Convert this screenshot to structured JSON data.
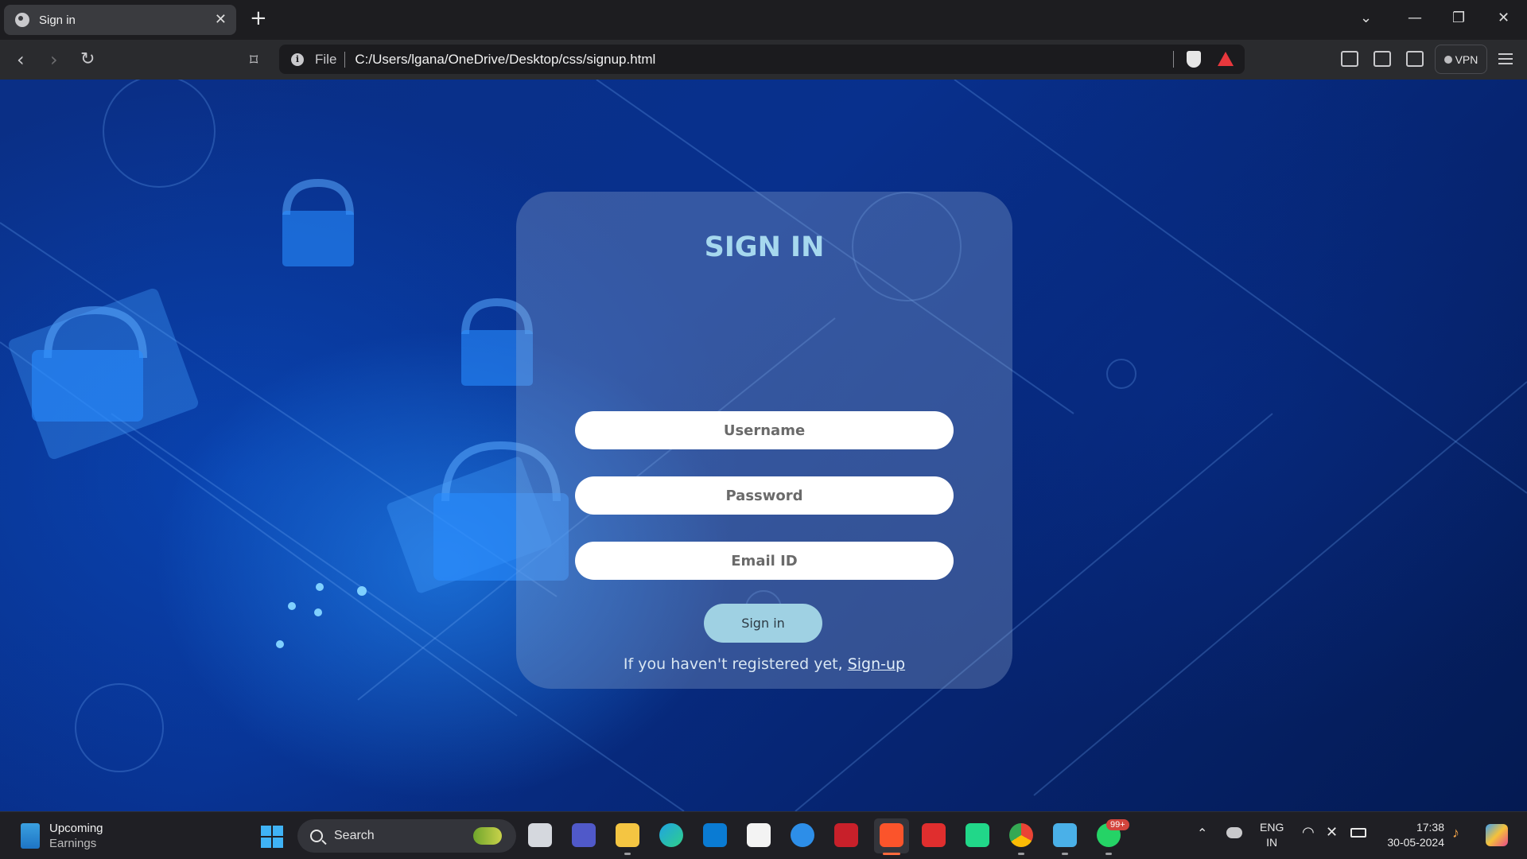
{
  "browser": {
    "tab_title": "Sign in",
    "address_scheme": "File",
    "address_url": "C:/Users/lgana/OneDrive/Desktop/css/signup.html",
    "vpn_label": "VPN"
  },
  "form": {
    "title": "SIGN IN",
    "username_placeholder": "Username",
    "password_placeholder": "Password",
    "email_placeholder": "Email ID",
    "submit_label": "Sign in",
    "register_text": "If you haven't registered yet,",
    "register_link": "Sign-up"
  },
  "taskbar": {
    "weather_title": "Upcoming",
    "weather_subtitle": "Earnings",
    "search_label": "Search",
    "notification_badge": "99+",
    "lang_primary": "ENG",
    "lang_secondary": "IN",
    "time": "17:38",
    "date": "30-05-2024"
  },
  "colors": {
    "card_title": "#a6d8ee",
    "submit_bg": "#9fd1e3",
    "brave_accent": "#e8383d"
  }
}
